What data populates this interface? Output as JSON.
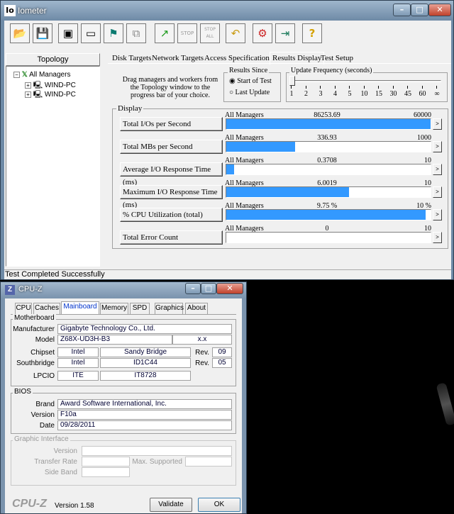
{
  "iometer": {
    "title": "Iometer",
    "icon_text": "Io",
    "caption": {
      "minimize": "–",
      "maximize": "□",
      "close": "✕"
    },
    "toolbar": [
      {
        "name": "open-config-icon",
        "glyph": "📂"
      },
      {
        "name": "save-config-icon",
        "glyph": "💾"
      },
      {
        "name": "start-disk-worker-icon",
        "glyph": "▣"
      },
      {
        "name": "start-network-worker-icon",
        "glyph": "▭"
      },
      {
        "name": "new-manager-icon",
        "glyph": "⚑"
      },
      {
        "name": "copy-worker-icon",
        "glyph": "⧉"
      },
      {
        "name": "start-tests-icon",
        "glyph": "↗"
      },
      {
        "name": "stop-icon",
        "glyph": "STOP"
      },
      {
        "name": "stop-all-icon",
        "glyph": "STOP ALL"
      },
      {
        "name": "reset-workers-icon",
        "glyph": "↶"
      },
      {
        "name": "disconnect-managers-icon",
        "glyph": "⚙"
      },
      {
        "name": "exit-icon",
        "glyph": "⇥"
      },
      {
        "name": "about-icon",
        "glyph": "?"
      }
    ],
    "topology": {
      "header": "Topology",
      "root": "All Managers",
      "managers": [
        "WIND-PC",
        "WIND-PC"
      ]
    },
    "tabs": [
      "Disk Targets",
      "Network Targets",
      "Access Specifications",
      "Results Display",
      "Test Setup"
    ],
    "selected_tab": "Results Display",
    "drag_hint": "Drag managers and workers from the Topology window to the progress bar of your choice.",
    "results_since": {
      "label": "Results Since",
      "options": [
        "Start of Test",
        "Last Update"
      ],
      "selected": "Start of Test"
    },
    "update_frequency": {
      "label": "Update Frequency (seconds)",
      "ticks": [
        "1",
        "2",
        "3",
        "4",
        "5",
        "10",
        "15",
        "30",
        "45",
        "60",
        "∞"
      ],
      "selected": "1"
    },
    "display": {
      "label": "Display",
      "rows": [
        {
          "button": "Total I/Os per Second",
          "source": "All Managers",
          "value": "86253.69",
          "max": "60000",
          "fraction": 1.0
        },
        {
          "button": "Total MBs per Second",
          "source": "All Managers",
          "value": "336.93",
          "max": "1000",
          "fraction": 0.337
        },
        {
          "button": "Average I/O Response Time (ms)",
          "source": "All Managers",
          "value": "0.3708",
          "max": "10",
          "fraction": 0.037
        },
        {
          "button": "Maximum I/O Response Time (ms)",
          "source": "All Managers",
          "value": "6.0019",
          "max": "10",
          "fraction": 0.6
        },
        {
          "button": "% CPU Utilization (total)",
          "source": "All Managers",
          "value": "9.75 %",
          "max": "10 %",
          "fraction": 0.975
        },
        {
          "button": "Total Error Count",
          "source": "All Managers",
          "value": "0",
          "max": "10",
          "fraction": 0.0
        }
      ],
      "arrow": ">"
    },
    "status": "Test Completed Successfully"
  },
  "cpuz": {
    "title": "CPU-Z",
    "icon_text": "Z",
    "caption": {
      "minimize": "–",
      "maximize": "□",
      "close": "✕"
    },
    "tabs": [
      "CPU",
      "Caches",
      "Mainboard",
      "Memory",
      "SPD",
      "Graphics",
      "About"
    ],
    "selected_tab": "Mainboard",
    "motherboard": {
      "label": "Motherboard",
      "manufacturer_label": "Manufacturer",
      "manufacturer": "Gigabyte Technology Co., Ltd.",
      "model_label": "Model",
      "model": "Z68X-UD3H-B3",
      "model_rev": "x.x",
      "chipset_label": "Chipset",
      "chipset_vendor": "Intel",
      "chipset_name": "Sandy Bridge",
      "chipset_rev_label": "Rev.",
      "chipset_rev": "09",
      "southbridge_label": "Southbridge",
      "southbridge_vendor": "Intel",
      "southbridge_name": "ID1C44",
      "southbridge_rev_label": "Rev.",
      "southbridge_rev": "05",
      "lpcio_label": "LPCIO",
      "lpcio_vendor": "ITE",
      "lpcio_name": "IT8728"
    },
    "bios": {
      "label": "BIOS",
      "brand_label": "Brand",
      "brand": "Award Software International, Inc.",
      "version_label": "Version",
      "version": "F10a",
      "date_label": "Date",
      "date": "09/28/2011"
    },
    "graphic": {
      "label": "Graphic Interface",
      "version_label": "Version",
      "transfer_label": "Transfer Rate",
      "max_supported_label": "Max. Supported",
      "side_band_label": "Side Band"
    },
    "footer": {
      "logo": "CPU-Z",
      "version": "Version 1.58",
      "validate": "Validate",
      "ok": "OK"
    }
  }
}
